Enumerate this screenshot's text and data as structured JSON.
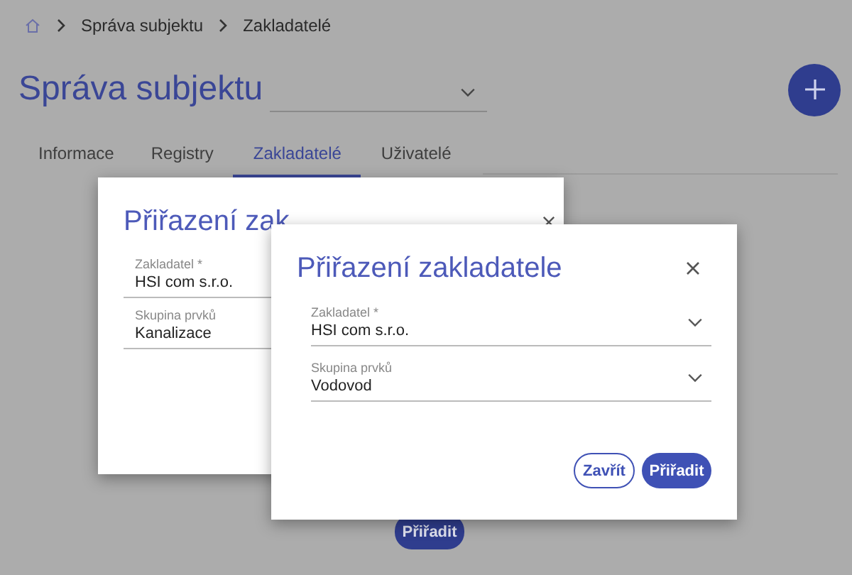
{
  "breadcrumb": [
    "Správa subjektu",
    "Zakladatelé"
  ],
  "page_title": "Správa subjektu",
  "tabs": [
    {
      "label": "Informace",
      "selected": false
    },
    {
      "label": "Registry",
      "selected": false
    },
    {
      "label": "Zakladatelé",
      "selected": true
    },
    {
      "label": "Uživatelé",
      "selected": false
    }
  ],
  "page_button": "Přiřadit",
  "back_dialog": {
    "title": "Přiřazení zak",
    "fields": [
      {
        "label": "Zakladatel *",
        "value": "HSI com s.r.o."
      },
      {
        "label": "Skupina prvků",
        "value": "Kanalizace"
      }
    ]
  },
  "dialog": {
    "title": "Přiřazení zakladatele",
    "fields": [
      {
        "label": "Zakladatel *",
        "value": "HSI com s.r.o."
      },
      {
        "label": "Skupina prvků",
        "value": "Vodovod"
      }
    ],
    "buttons": [
      "Zavřít",
      "Přiřadit"
    ]
  }
}
